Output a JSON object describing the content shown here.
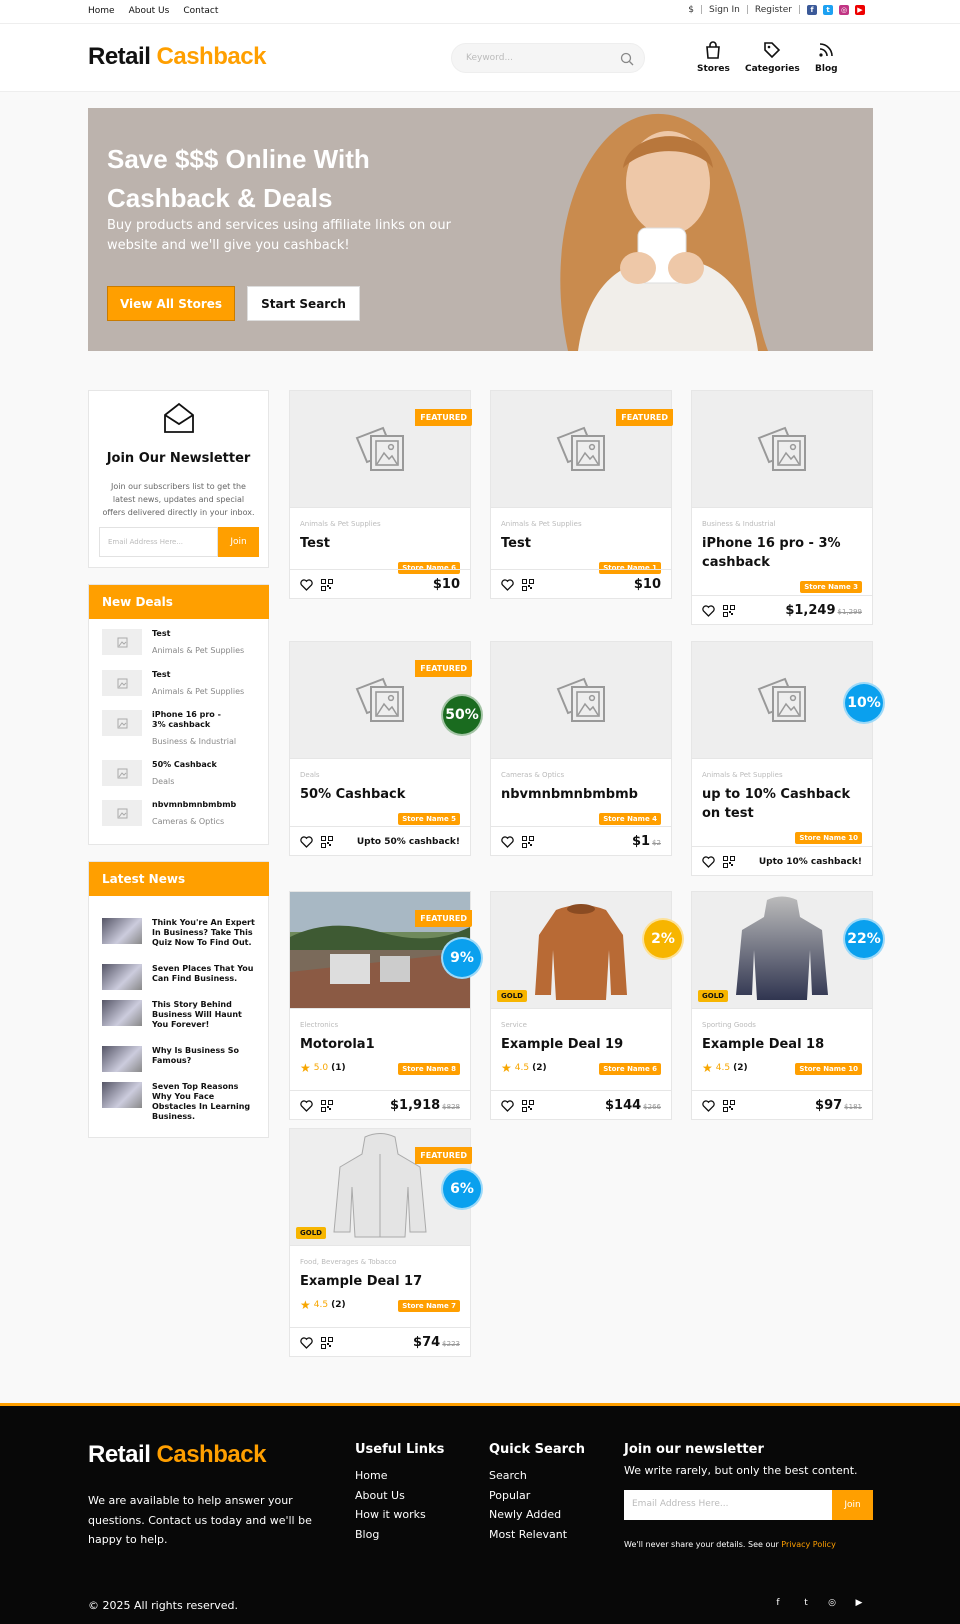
{
  "topbar": {
    "links": [
      "Home",
      "About Us",
      "Contact"
    ],
    "currency": "$",
    "sign_in": "Sign In",
    "register": "Register",
    "socials": [
      "facebook-icon",
      "twitter-icon",
      "instagram-icon",
      "youtube-icon"
    ]
  },
  "header": {
    "logo_a": "Retail",
    "logo_b": "Cashback",
    "search_placeholder": "Keyword...",
    "nav": [
      "Stores",
      "Categories",
      "Blog"
    ]
  },
  "hero": {
    "title": "Save $$$ Online With Cashback & Deals",
    "subtitle": "Buy products and services using affiliate links on our website and we'll give you cashback!",
    "btn_primary": "View All Stores",
    "btn_secondary": "Start Search"
  },
  "newsletter": {
    "title": "Join Our Newsletter",
    "text": "Join our subscribers list to get the latest news, updates and special offers delivered directly in your inbox.",
    "placeholder": "Email Address Here...",
    "button": "Join"
  },
  "new_deals": {
    "title": "New Deals",
    "items": [
      {
        "title": "Test",
        "cat": "Animals & Pet Supplies"
      },
      {
        "title": "Test",
        "cat": "Animals & Pet Supplies"
      },
      {
        "title": "iPhone 16 pro - 3% cashback",
        "cat": "Business & Industrial"
      },
      {
        "title": "50% Cashback",
        "cat": "Deals"
      },
      {
        "title": "nbvmnbmnbmbmb",
        "cat": "Cameras & Optics"
      }
    ]
  },
  "latest_news": {
    "title": "Latest News",
    "items": [
      "Think You're An Expert In Business? Take This Quiz Now To Find Out.",
      "Seven Places That You Can Find Business.",
      "This Story Behind Business Will Haunt You Forever!",
      "Why Is Business So Famous?",
      "Seven Top Reasons Why You Face Obstacles In Learning Business."
    ]
  },
  "cards": [
    {
      "cat": "Animals & Pet Supplies",
      "title": "Test",
      "store": "Store Name 6",
      "price": "$10",
      "old": "",
      "featured": "FEATURED"
    },
    {
      "cat": "Animals & Pet Supplies",
      "title": "Test",
      "store": "Store Name 1",
      "price": "$10",
      "old": "",
      "featured": "FEATURED"
    },
    {
      "cat": "Business & Industrial",
      "title": "iPhone 16 pro - 3% cashback",
      "store": "Store Name 3",
      "price": "$1,249",
      "old": "$1,299"
    },
    {
      "cat": "Deals",
      "title": "50% Cashback",
      "store": "Store Name 5",
      "price": "Upto 50% cashback!",
      "featured": "FEATURED",
      "pct": "50%"
    },
    {
      "cat": "Cameras & Optics",
      "title": "nbvmnbmnbmbmb",
      "store": "Store Name 4",
      "price": "$1",
      "old": "$2"
    },
    {
      "cat": "Animals & Pet Supplies",
      "title": "up to 10% Cashback on test",
      "store": "Store Name 10",
      "price": "Upto 10% cashback!",
      "pct": "10%"
    },
    {
      "cat": "Electronics",
      "title": "Motorola1",
      "store": "Store Name 8",
      "rating": "5.0",
      "reviews": "(1)",
      "price": "$1,918",
      "old": "$828",
      "featured": "FEATURED",
      "pct": "9%"
    },
    {
      "cat": "Service",
      "title": "Example Deal 19",
      "store": "Store Name 6",
      "rating": "4.5",
      "reviews": "(2)",
      "price": "$144",
      "old": "$266",
      "pct": "2%",
      "gold": "GOLD"
    },
    {
      "cat": "Sporting Goods",
      "title": "Example Deal 18",
      "store": "Store Name 10",
      "rating": "4.5",
      "reviews": "(2)",
      "price": "$97",
      "old": "$181",
      "pct": "22%",
      "gold": "GOLD"
    },
    {
      "cat": "Food, Beverages & Tobacco",
      "title": "Example Deal 17",
      "store": "Store Name 7",
      "rating": "4.5",
      "reviews": "(2)",
      "price": "$74",
      "old": "$223",
      "featured": "FEATURED",
      "pct": "6%",
      "gold": "GOLD"
    }
  ],
  "colors": {
    "accent": "#ff9f00",
    "pct_green": "#1a6b1f",
    "pct_blue": "#0aa0ee",
    "pct_yellow": "#f7b500"
  },
  "footer": {
    "logo_a": "Retail",
    "logo_b": "Cashback",
    "desc": "We are available to help answer your questions. Contact us today and we'll be happy to help.",
    "useful_title": "Useful Links",
    "useful": [
      "Home",
      "About Us",
      "How it works",
      "Blog"
    ],
    "quick_title": "Quick Search",
    "quick": [
      "Search",
      "Popular",
      "Newly Added",
      "Most Relevant"
    ],
    "nl_title": "Join our newsletter",
    "nl_text": "We write rarely, but only the best content.",
    "nl_placeholder": "Email Address Here...",
    "nl_button": "Join",
    "privacy_text": "We'll never share your details. See our",
    "privacy_link": "Privacy Policy",
    "copyright": "© 2025 All rights reserved."
  }
}
